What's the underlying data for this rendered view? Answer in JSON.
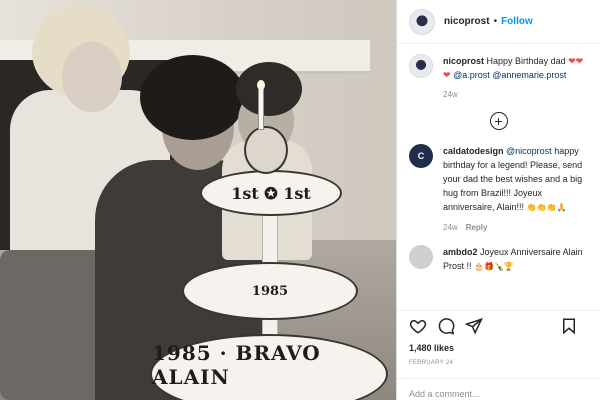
{
  "header": {
    "username": "nicoprost",
    "separator": "•",
    "follow_label": "Follow"
  },
  "photo": {
    "cake_top_text": "1st ✪ 1st",
    "cake_middle_text": "1985",
    "cake_bottom_text": "1985 · BRAVO ALAIN"
  },
  "caption": {
    "username": "nicoprost",
    "text": "Happy Birthday dad",
    "hearts": "❤❤❤",
    "mention1": "@a.prost",
    "mention2": "@annemarie.prost",
    "time": "24w"
  },
  "more_comments_label": "+",
  "comments": [
    {
      "avatar_text": "C",
      "username": "caldatodesign",
      "mention": "@nicoprost",
      "text": "happy birthday for a legend! Please, send your dad the best wishes and a big hug from Brazil!!! Joyeux anniversaire, Alain!!!",
      "emoji": "👏👏👏🙏",
      "time": "24w",
      "reply_label": "Reply"
    },
    {
      "avatar_text": "",
      "username": "ambdo2",
      "text": "Joyeux Anniversaire Alain Prost !!",
      "emoji": "🎂🎁🍾🏆"
    }
  ],
  "actions": {
    "likes": "1,480 likes",
    "date": "FEBRUARY 24"
  },
  "add_comment": {
    "placeholder": "Add a comment..."
  },
  "icons": {
    "like": "heart-icon",
    "comment": "comment-icon",
    "share": "send-icon",
    "save": "bookmark-icon"
  }
}
